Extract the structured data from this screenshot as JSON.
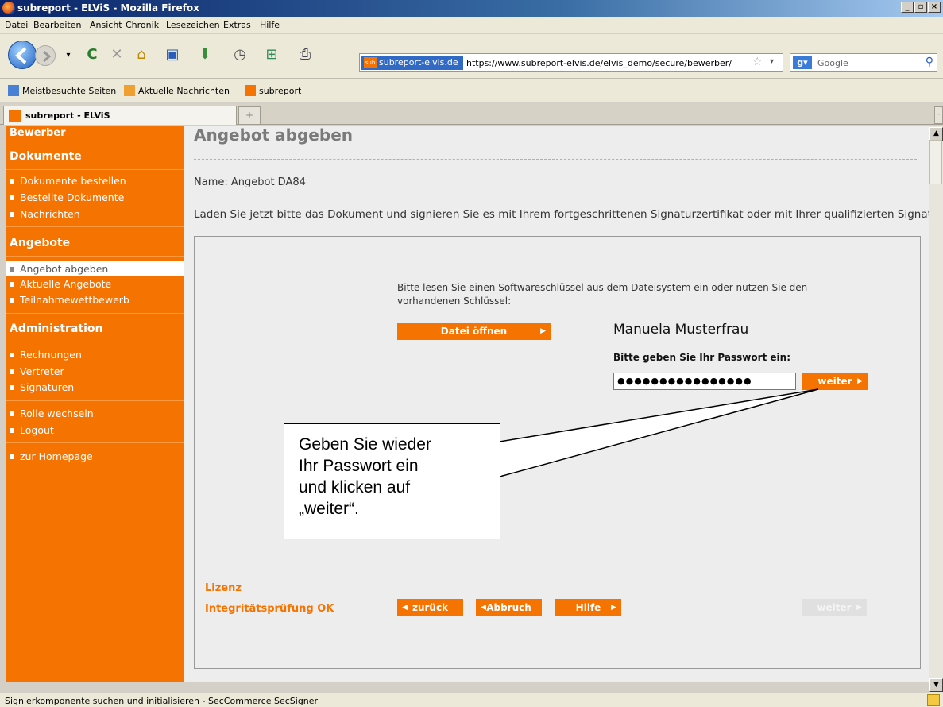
{
  "window": {
    "title": "subreport - ELViS - Mozilla Firefox"
  },
  "menu": [
    "Datei",
    "Bearbeiten",
    "Ansicht",
    "Chronik",
    "Lesezeichen",
    "Extras",
    "Hilfe"
  ],
  "address": {
    "site_label": "subreport-elvis.de",
    "url": "https://www.subreport-elvis.de/elvis_demo/secure/bewerber/",
    "search_placeholder": "Google"
  },
  "bookmarks": [
    "Meistbesuchte Seiten",
    "Aktuelle Nachrichten",
    "subreport"
  ],
  "tabs": {
    "active": "subreport - ELViS",
    "new_tab": "+"
  },
  "sidebar": {
    "top_label": "Bewerber",
    "sections": [
      {
        "heading": "Dokumente",
        "items": [
          "Dokumente bestellen",
          "Bestellte Dokumente",
          "Nachrichten"
        ]
      },
      {
        "heading": "Angebote",
        "items": [
          "Angebot abgeben",
          "Aktuelle Angebote",
          "Teilnahmewettbewerb"
        ]
      },
      {
        "heading": "Administration",
        "items": [
          "Rechnungen",
          "Vertreter",
          "Signaturen"
        ]
      }
    ],
    "extra": [
      "Rolle wechseln",
      "Logout"
    ],
    "home": "zur Homepage"
  },
  "main": {
    "title": "Angebot abgeben",
    "name_line": "Name: Angebot DA84",
    "instruction": "Laden Sie jetzt bitte das Dokument und signieren Sie es mit Ihrem fortgeschrittenen Signaturzertifikat oder mit Ihrer qualifizierten Signatur.",
    "applet": {
      "prompt_line1": "Bitte lesen Sie einen Softwareschlüssel aus dem Dateisystem ein oder nutzen Sie den",
      "prompt_line2": "vorhandenen Schlüssel:",
      "open_file": "Datei öffnen",
      "user_name": "Manuela Musterfrau",
      "password_label": "Bitte geben Sie Ihr Passwort ein:",
      "password_value": "●●●●●●●●●●●●●●●●",
      "weiter": "weiter",
      "lizenz": "Lizenz",
      "integrity": "Integritätsprüfung OK",
      "back": "zurück",
      "cancel": "Abbruch",
      "help": "Hilfe",
      "weiter_disabled": "weiter"
    }
  },
  "callout": {
    "text": "Geben Sie wieder\nIhr Passwort ein\nund klicken auf\n„weiter“."
  },
  "status": {
    "text": "Signierkomponente suchen und initialisieren  - SecCommerce SecSigner"
  },
  "colors": {
    "brand_orange": "#f57300",
    "title_blue": "#0a246a"
  }
}
